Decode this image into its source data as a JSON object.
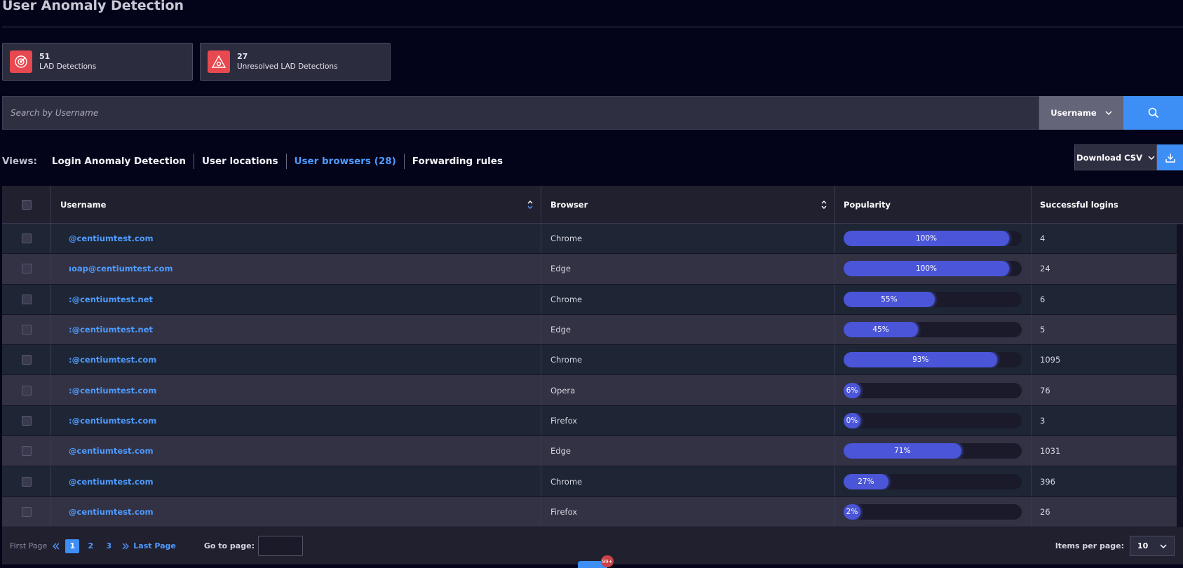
{
  "header": {
    "title": "User Anomaly Detection"
  },
  "stats": [
    {
      "count": "51",
      "label": "LAD Detections"
    },
    {
      "count": "27",
      "label": "Unresolved LAD Detections"
    }
  ],
  "search": {
    "placeholder": "Search by Username",
    "value": "",
    "field": "Username"
  },
  "views": {
    "label": "Views:",
    "tabs": [
      {
        "label": "Login Anomaly Detection",
        "active": false
      },
      {
        "label": "User locations",
        "active": false
      },
      {
        "label": "User browsers (28)",
        "active": true
      },
      {
        "label": "Forwarding rules",
        "active": false
      }
    ]
  },
  "csv": {
    "label": "Download CSV"
  },
  "table": {
    "columns": [
      "Username",
      "Browser",
      "Popularity",
      "Successful logins"
    ],
    "rows": [
      {
        "user": "@centiumtest.com",
        "browser": "Chrome",
        "popularity": 100,
        "pop_label": "100%",
        "logins": "4"
      },
      {
        "user": "ıoap@centiumtest.com",
        "browser": "Edge",
        "popularity": 100,
        "pop_label": "100%",
        "logins": "24"
      },
      {
        "user": ":@centiumtest.net",
        "browser": "Chrome",
        "popularity": 55,
        "pop_label": "55%",
        "logins": "6"
      },
      {
        "user": ":@centiumtest.net",
        "browser": "Edge",
        "popularity": 45,
        "pop_label": "45%",
        "logins": "5"
      },
      {
        "user": ":@centiumtest.com",
        "browser": "Chrome",
        "popularity": 93,
        "pop_label": "93%",
        "logins": "1095"
      },
      {
        "user": ":@centiumtest.com",
        "browser": "Opera",
        "popularity": 6,
        "pop_label": "6%",
        "logins": "76"
      },
      {
        "user": ":@centiumtest.com",
        "browser": "Firefox",
        "popularity": 0,
        "pop_label": "0%",
        "logins": "3"
      },
      {
        "user": "@centiumtest.com",
        "browser": "Edge",
        "popularity": 71,
        "pop_label": "71%",
        "logins": "1031"
      },
      {
        "user": "@centiumtest.com",
        "browser": "Chrome",
        "popularity": 27,
        "pop_label": "27%",
        "logins": "396"
      },
      {
        "user": "@centiumtest.com",
        "browser": "Firefox",
        "popularity": 2,
        "pop_label": "2%",
        "logins": "26"
      }
    ]
  },
  "pager": {
    "first": "First Page",
    "pages": [
      "1",
      "2",
      "3"
    ],
    "current": "1",
    "last": "Last Page",
    "goto_label": "Go to page:",
    "ipp_label": "Items per page:",
    "ipp_value": "10"
  },
  "notification": {
    "badge": "99+"
  },
  "colors": {
    "accent": "#3d8ef5",
    "alert": "#e8484f",
    "bar": "#4a55d8"
  }
}
